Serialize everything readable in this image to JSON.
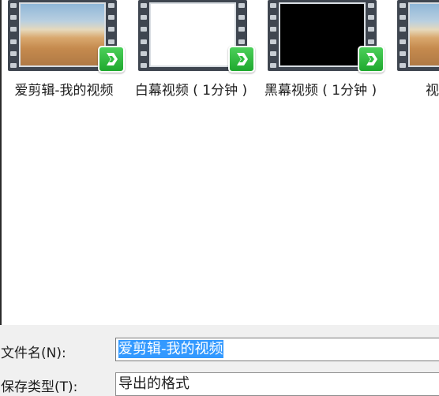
{
  "files": [
    {
      "name": "爱剪辑-我的视频",
      "thumb": "desert-scene",
      "badge_icon": "aijianji-logo-icon"
    },
    {
      "name": "白幕视频 ( 1分钟 )",
      "thumb": "white-frame",
      "badge_icon": "aijianji-logo-icon"
    },
    {
      "name": "黑幕视频 ( 1分钟 )",
      "thumb": "black-frame",
      "badge_icon": "aijianji-logo-icon"
    },
    {
      "name": "视",
      "thumb": "desert-scene"
    }
  ],
  "filename_row": {
    "label": "文件名(N):",
    "value": "爱剪辑-我的视频"
  },
  "filetype_row": {
    "label": "保存类型(T):",
    "value": "导出的格式"
  },
  "colors": {
    "selection": "#3399ff",
    "badge": "#2fbf3f",
    "panel": "#f0f0f0"
  }
}
